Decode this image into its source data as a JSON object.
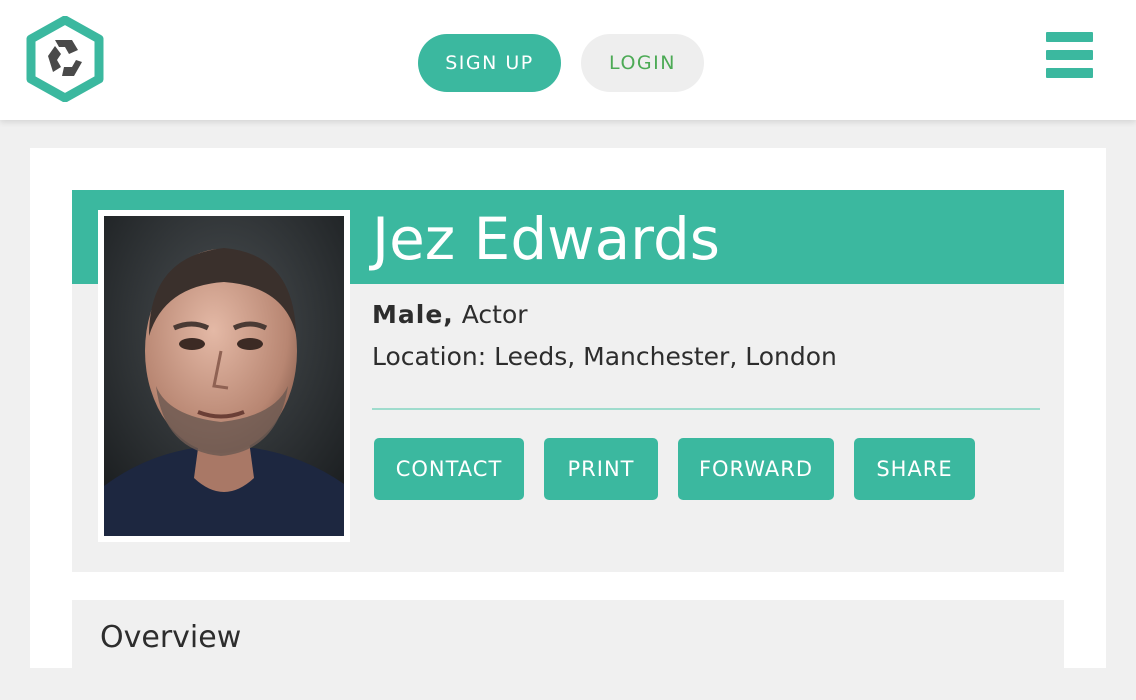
{
  "header": {
    "logo_icon": "hexagon-logo-icon",
    "signup_label": "SIGN UP",
    "login_label": "LOGIN",
    "menu_icon": "hamburger-menu-icon"
  },
  "profile": {
    "name": "Jez Edwards",
    "gender": "Male,",
    "role": "Actor",
    "location": "Location: Leeds, Manchester, London",
    "photo_icon": "headshot-photo"
  },
  "actions": {
    "contact": "CONTACT",
    "print": "PRINT",
    "forward": "FORWARD",
    "share": "SHARE"
  },
  "overview": {
    "title": "Overview"
  },
  "colors": {
    "accent": "#3bb89f",
    "login_text": "#4caa55",
    "panel_bg": "#f0f0f0",
    "text": "#2d2d2d"
  }
}
